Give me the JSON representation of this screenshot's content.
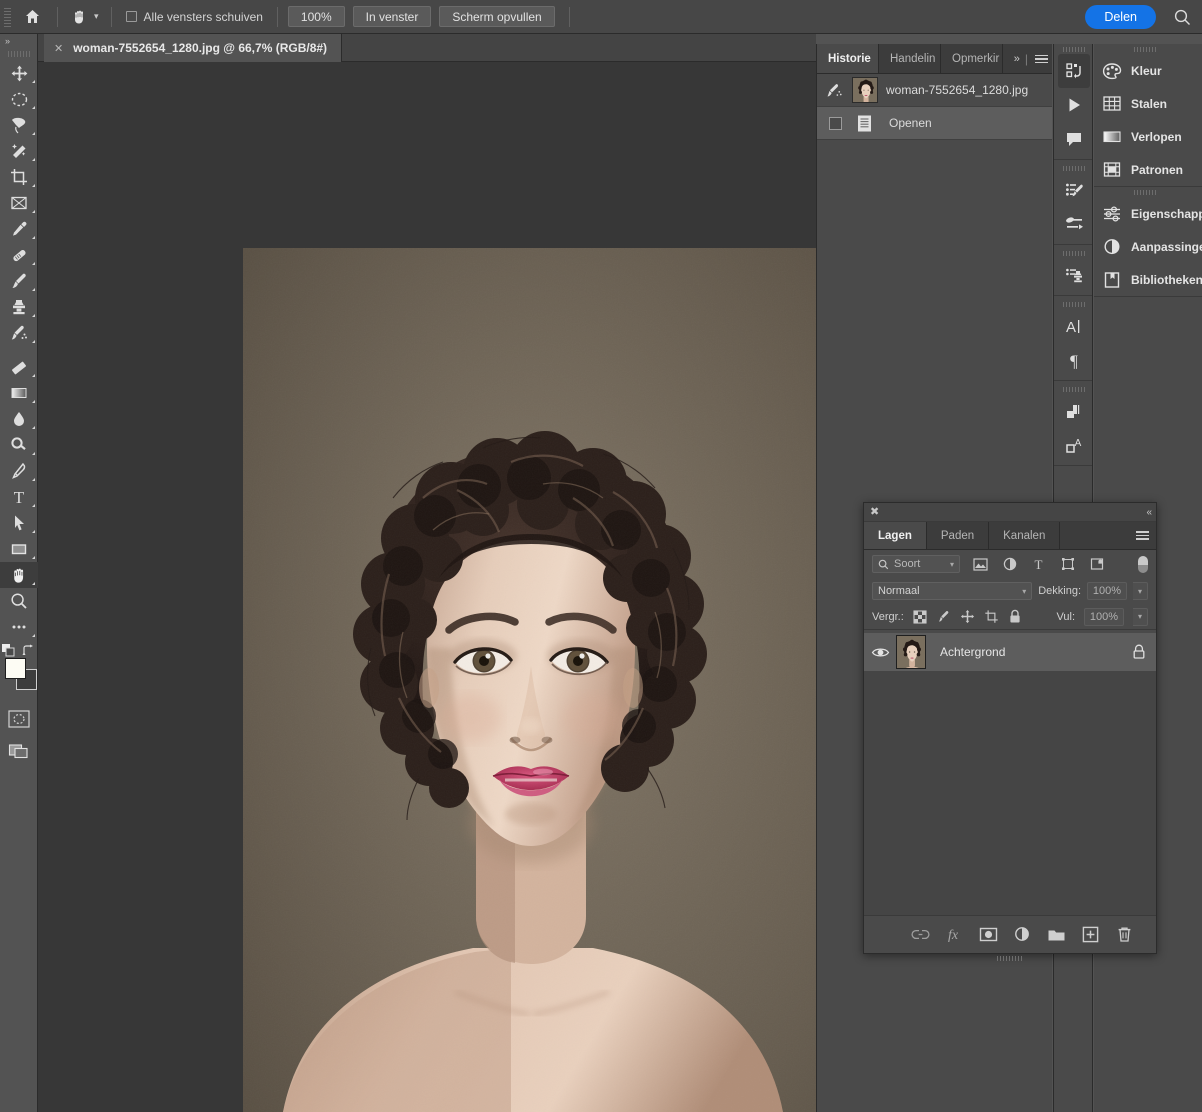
{
  "options_bar": {
    "home_icon": "home-icon",
    "active_tool_icon": "hand-tool-icon",
    "tool_chevron": "chevron-down-icon",
    "scroll_all_windows_label": "Alle vensters schuiven",
    "scroll_all_windows_checked": false,
    "buttons": [
      {
        "label": "100%",
        "name": "zoom-100-button"
      },
      {
        "label": "In venster",
        "name": "fit-in-window-button"
      },
      {
        "label": "Scherm opvullen",
        "name": "fill-screen-button"
      }
    ],
    "share_label": "Delen",
    "share_color": "#1473e6",
    "search_icon": "search-icon"
  },
  "toolbar": {
    "expand_icon": "double-chevron-right-icon",
    "tools": [
      {
        "name": "move-tool",
        "icon": "move-icon",
        "active": false
      },
      {
        "name": "marquee-tool",
        "icon": "elliptical-marquee-icon",
        "active": false
      },
      {
        "name": "lasso-tool",
        "icon": "lasso-icon",
        "active": false
      },
      {
        "name": "quick-selection-tool",
        "icon": "magic-wand-icon",
        "active": false
      },
      {
        "name": "crop-tool",
        "icon": "crop-icon",
        "active": false
      },
      {
        "name": "frame-tool",
        "icon": "frame-icon",
        "active": false
      },
      {
        "name": "eyedropper-tool",
        "icon": "eyedropper-icon",
        "active": false
      },
      {
        "name": "healing-brush-tool",
        "icon": "healing-brush-icon",
        "active": false
      },
      {
        "name": "brush-tool",
        "icon": "brush-icon",
        "active": false
      },
      {
        "name": "clone-stamp-tool",
        "icon": "clone-stamp-icon",
        "active": false
      },
      {
        "name": "history-brush-tool",
        "icon": "history-brush-icon",
        "active": false
      },
      {
        "name": "eraser-tool",
        "icon": "eraser-icon",
        "active": false
      },
      {
        "name": "gradient-tool",
        "icon": "gradient-icon",
        "active": false
      },
      {
        "name": "blur-tool",
        "icon": "blur-drop-icon",
        "active": false
      },
      {
        "name": "dodge-tool",
        "icon": "dodge-icon",
        "active": false
      },
      {
        "name": "pen-tool",
        "icon": "pen-icon",
        "active": false
      },
      {
        "name": "type-tool",
        "icon": "type-t-icon",
        "active": false
      },
      {
        "name": "path-selection-tool",
        "icon": "path-arrow-icon",
        "active": false
      },
      {
        "name": "rectangle-tool",
        "icon": "rectangle-icon",
        "active": false
      },
      {
        "name": "hand-tool",
        "icon": "hand-icon",
        "active": true
      },
      {
        "name": "zoom-tool",
        "icon": "magnifier-icon",
        "active": false
      },
      {
        "name": "edit-toolbar",
        "icon": "ellipsis-icon",
        "active": false
      }
    ],
    "default_colors_icon": "default-colors-icon",
    "swap_colors_icon": "swap-colors-icon",
    "foreground_color": "#fdfcf4",
    "background_color": "#3d3d3d",
    "quick_mask_icon": "quick-mask-icon",
    "screen_mode_icon": "screen-mode-icon"
  },
  "document": {
    "close_icon": "close-icon",
    "tab_title": "woman-7552654_1280.jpg @ 66,7% (RGB/8#)",
    "canvas_background": "#373737",
    "image_background": "#6b6154"
  },
  "history_panel": {
    "tabs": [
      {
        "label": "Historie",
        "active": true,
        "name": "tab-historie"
      },
      {
        "label": "Handelin",
        "active": false,
        "name": "tab-handelingen"
      },
      {
        "label": "Opmerkir",
        "active": false,
        "name": "tab-opmerkingen"
      }
    ],
    "expand_icon": "double-chevron-right-icon",
    "menu_icon": "panel-menu-icon",
    "snapshot": {
      "icon": "history-brush-icon",
      "label": "woman-7552654_1280.jpg"
    },
    "states": [
      {
        "icon": "document-icon",
        "label": "Openen",
        "selected": true,
        "name": "history-state-openen"
      }
    ]
  },
  "dock_strip": {
    "icons": [
      {
        "name": "dock-history-icon",
        "icon": "history-panel-icon",
        "active": true
      },
      {
        "name": "dock-actions-icon",
        "icon": "play-triangle-icon",
        "active": false
      },
      {
        "name": "dock-comments-icon",
        "icon": "comment-bubble-icon",
        "active": false
      },
      {
        "name": "dock-brushes-icon",
        "icon": "brushes-icon",
        "active": false
      },
      {
        "name": "dock-brush-settings-icon",
        "icon": "brush-settings-icon",
        "active": false
      },
      {
        "name": "dock-clone-source-icon",
        "icon": "clone-source-icon",
        "active": false
      },
      {
        "name": "dock-character-icon",
        "icon": "character-a-icon",
        "active": false
      },
      {
        "name": "dock-paragraph-icon",
        "icon": "paragraph-pilcrow-icon",
        "active": false
      },
      {
        "name": "dock-character-styles-icon",
        "icon": "character-styles-icon",
        "active": false
      },
      {
        "name": "dock-paragraph-styles-icon",
        "icon": "paragraph-styles-icon",
        "active": false
      }
    ]
  },
  "right_dock": {
    "groups": [
      [
        {
          "label": "Kleur",
          "icon": "color-palette-icon",
          "name": "panel-kleur"
        },
        {
          "label": "Stalen",
          "icon": "swatches-grid-icon",
          "name": "panel-stalen"
        },
        {
          "label": "Verlopen",
          "icon": "gradient-icon",
          "name": "panel-verlopen"
        },
        {
          "label": "Patronen",
          "icon": "patterns-icon",
          "name": "panel-patronen"
        }
      ],
      [
        {
          "label": "Eigenschappen",
          "icon": "properties-sliders-icon",
          "name": "panel-eigenschappen"
        },
        {
          "label": "Aanpassingen",
          "icon": "adjustments-circle-icon",
          "name": "panel-aanpassingen"
        },
        {
          "label": "Bibliotheken",
          "icon": "libraries-book-icon",
          "name": "panel-bibliotheken"
        }
      ]
    ]
  },
  "layers_panel": {
    "close_icon": "close-icon",
    "collapse_icon": "double-chevron-left-icon",
    "menu_icon": "panel-menu-icon",
    "tabs": [
      {
        "label": "Lagen",
        "active": true,
        "name": "tab-lagen"
      },
      {
        "label": "Paden",
        "active": false,
        "name": "tab-paden"
      },
      {
        "label": "Kanalen",
        "active": false,
        "name": "tab-kanalen"
      }
    ],
    "filter": {
      "search_icon": "search-icon",
      "value": "Soort",
      "chevron": "chevron-down-icon",
      "type_icons": [
        {
          "name": "filter-pixel-icon",
          "icon": "image-icon"
        },
        {
          "name": "filter-adjustment-icon",
          "icon": "adjustments-circle-icon"
        },
        {
          "name": "filter-text-icon",
          "icon": "type-t-icon"
        },
        {
          "name": "filter-shape-icon",
          "icon": "shape-icon"
        },
        {
          "name": "filter-smart-icon",
          "icon": "smart-object-icon"
        }
      ],
      "toggle_icon": "filter-toggle-switch"
    },
    "blend_mode": "Normaal",
    "opacity_label": "Dekking:",
    "opacity_value": "100%",
    "lock_label": "Vergr.:",
    "lock_icons": [
      {
        "name": "lock-transparency-icon",
        "icon": "checkerboard-icon"
      },
      {
        "name": "lock-image-icon",
        "icon": "brush-icon"
      },
      {
        "name": "lock-position-icon",
        "icon": "move-icon"
      },
      {
        "name": "lock-nesting-icon",
        "icon": "artboard-icon"
      },
      {
        "name": "lock-all-icon",
        "icon": "padlock-icon"
      }
    ],
    "fill_label": "Vul:",
    "fill_value": "100%",
    "layers": [
      {
        "name": "layer-achtergrond",
        "label": "Achtergrond",
        "visible": true,
        "locked": true,
        "selected": true
      }
    ],
    "footer_icons": [
      {
        "name": "link-layers-button",
        "icon": "link-icon"
      },
      {
        "name": "layer-styles-button",
        "icon": "fx-icon"
      },
      {
        "name": "layer-mask-button",
        "icon": "mask-icon"
      },
      {
        "name": "adjustment-layer-button",
        "icon": "adjustments-circle-icon"
      },
      {
        "name": "new-group-button",
        "icon": "folder-icon"
      },
      {
        "name": "new-layer-button",
        "icon": "plus-square-icon"
      },
      {
        "name": "delete-layer-button",
        "icon": "trash-icon"
      }
    ]
  }
}
